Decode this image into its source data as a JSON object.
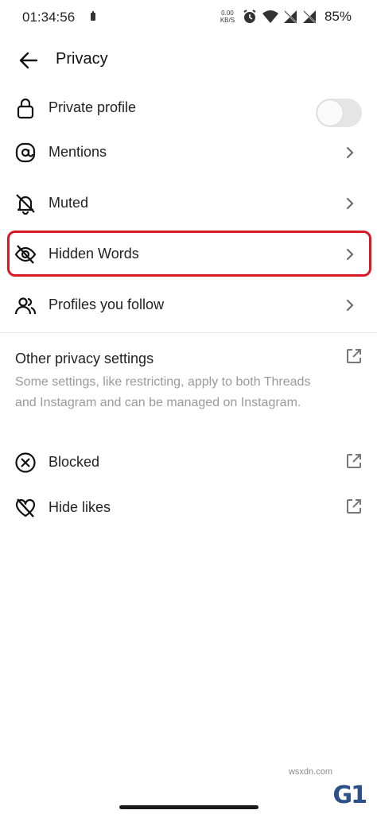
{
  "status_bar": {
    "time": "01:34:56",
    "net_speed_value": "0.00",
    "net_speed_unit": "KB/S",
    "battery": "85%"
  },
  "header": {
    "title": "Privacy"
  },
  "menu_items": [
    {
      "label": "Private profile",
      "icon": "lock-icon",
      "trailing": "toggle",
      "toggle_on": false
    },
    {
      "label": "Mentions",
      "icon": "at-sign-icon",
      "trailing": "chevron"
    },
    {
      "label": "Muted",
      "icon": "bell-off-icon",
      "trailing": "chevron"
    },
    {
      "label": "Hidden Words",
      "icon": "eye-off-icon",
      "trailing": "chevron",
      "highlighted": true
    },
    {
      "label": "Profiles you follow",
      "icon": "people-icon",
      "trailing": "chevron"
    }
  ],
  "other_section": {
    "title": "Other privacy settings",
    "description": "Some settings, like restricting, apply to both Threads and Instagram and can be managed on Instagram.",
    "items": [
      {
        "label": "Blocked",
        "icon": "blocked-icon"
      },
      {
        "label": "Hide likes",
        "icon": "heart-off-icon"
      }
    ]
  },
  "colors": {
    "highlight": "#d81923",
    "muted_text": "#9a9a9a",
    "toggle_off": "#e5e5e5"
  },
  "watermark": {
    "text": "G1",
    "subtext": "wsxdn.com"
  }
}
